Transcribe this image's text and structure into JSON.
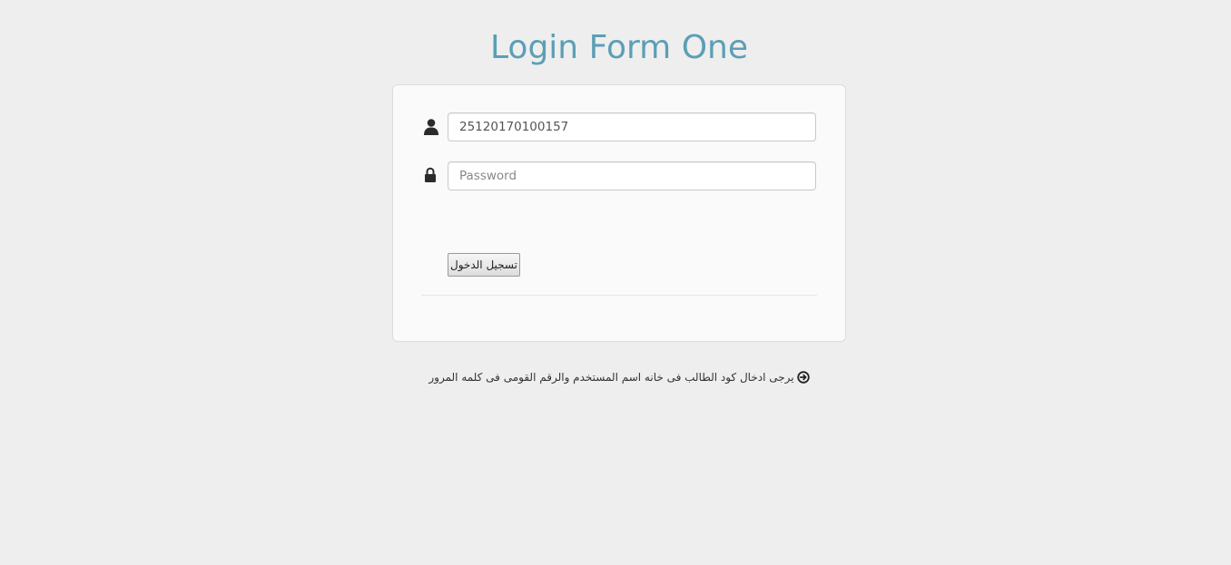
{
  "page": {
    "title": "Login Form One"
  },
  "login_form": {
    "username": {
      "value": "25120170100157",
      "icon": "user-icon"
    },
    "password": {
      "value": "",
      "placeholder": "Password",
      "icon": "lock-icon"
    },
    "submit_label": "تسجيل الدخول"
  },
  "footer": {
    "note": "يرجى ادخال كود الطالب فى خانه اسم المستخدم والرقم القومى فى كلمه المرور",
    "icon": "circle-arrow-right-icon"
  },
  "colors": {
    "background": "#eeeeee",
    "title": "#5b9fb5",
    "card": "#fafafa"
  }
}
